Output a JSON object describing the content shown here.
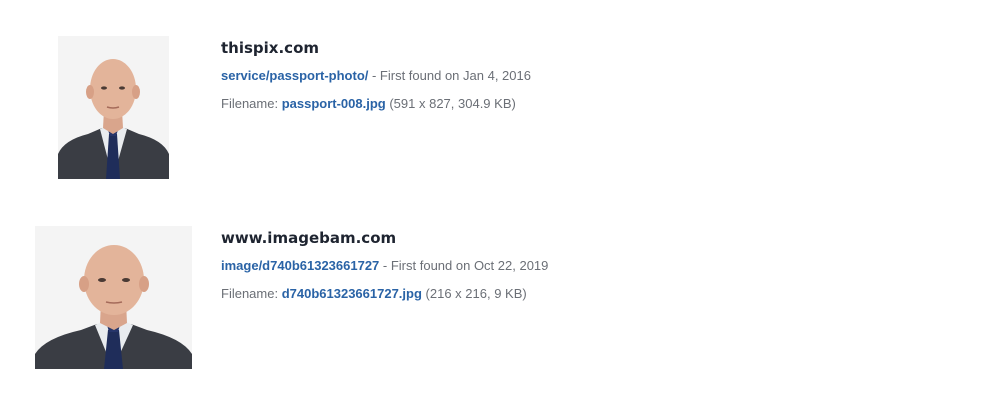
{
  "results": [
    {
      "domain": "thispix.com",
      "path": "service/passport-photo/",
      "found_text": " - First found on Jan 4, 2016",
      "filename_label": "Filename: ",
      "filename": "passport-008.jpg",
      "details": " (591 x 827, 304.9 KB)",
      "thumbnail": "passport-photo-man-suit-icon"
    },
    {
      "domain": "www.imagebam.com",
      "path": "image/d740b61323661727",
      "found_text": " - First found on Oct 22, 2019",
      "filename_label": "Filename: ",
      "filename": "d740b61323661727.jpg",
      "details": " (216 x 216, 9 KB)",
      "thumbnail": "passport-photo-man-suit-icon"
    }
  ],
  "colors": {
    "link": "#2a63a6",
    "domain": "#1e2430",
    "meta": "#6b6f76",
    "suit": "#3a3d44",
    "tie": "#1f2d5a"
  }
}
